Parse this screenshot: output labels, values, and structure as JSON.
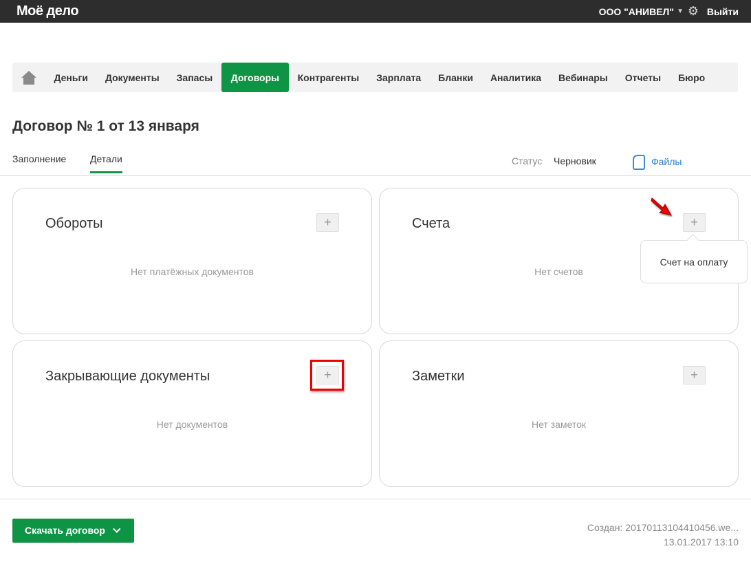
{
  "header": {
    "logo": "Моё дело",
    "org": "ООО \"АНИВЕЛ\"",
    "logout": "Выйти"
  },
  "nav": {
    "items": [
      "Деньги",
      "Документы",
      "Запасы",
      "Договоры",
      "Контрагенты",
      "Зарплата",
      "Бланки",
      "Аналитика",
      "Вебинары",
      "Отчеты",
      "Бюро"
    ],
    "active": "Договоры"
  },
  "page": {
    "title": "Договор № 1 от 13 января",
    "tabs": [
      "Заполнение",
      "Детали"
    ],
    "active_tab": "Детали",
    "status_label": "Статус",
    "status_value": "Черновик",
    "files": "Файлы"
  },
  "cards": [
    {
      "title": "Обороты",
      "empty": "Нет платёжных документов",
      "plus": "+"
    },
    {
      "title": "Счета",
      "empty": "Нет счетов",
      "plus": "+"
    },
    {
      "title": "Закрывающие документы",
      "empty": "Нет документов",
      "plus": "+"
    },
    {
      "title": "Заметки",
      "empty": "Нет заметок",
      "plus": "+"
    }
  ],
  "popup": {
    "item": "Счет на оплату"
  },
  "footer": {
    "download": "Скачать договор",
    "created": "Создан: 20170113104410456.we...",
    "date": "13.01.2017 13:10"
  },
  "colors": {
    "accent": "#0e9444",
    "topbar": "#2d2d2d",
    "link": "#2a7fc9"
  }
}
